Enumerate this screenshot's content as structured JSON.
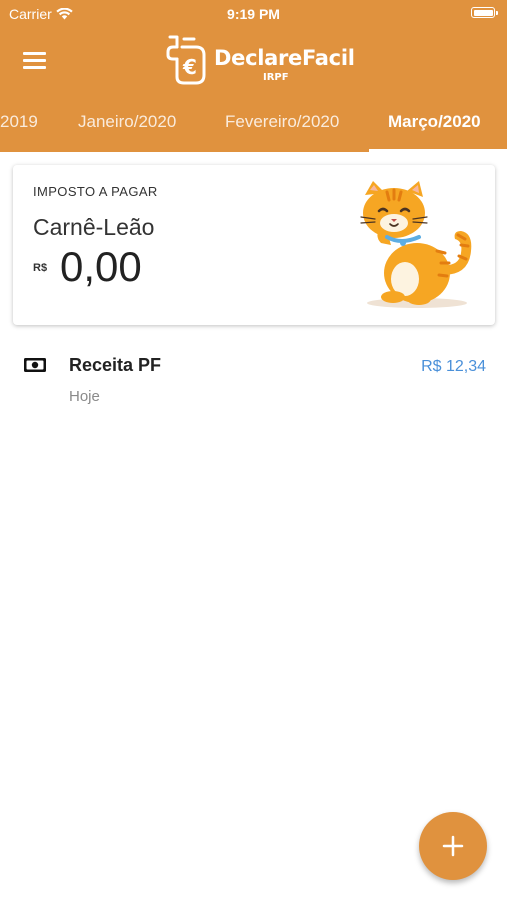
{
  "status_bar": {
    "carrier": "Carrier",
    "time": "9:19 PM"
  },
  "header": {
    "logo_text": "DeclareFacil",
    "logo_subtitle": "IRPF",
    "background_color": "#e0923e",
    "menu_icon": "hamburger-icon"
  },
  "tabs": [
    {
      "label": "2019",
      "active": false
    },
    {
      "label": "Janeiro/2020",
      "active": false
    },
    {
      "label": "Fevereiro/2020",
      "active": false
    },
    {
      "label": "Março/2020",
      "active": true
    }
  ],
  "tax_card": {
    "label": "IMPOSTO A PAGAR",
    "title": "Carnê-Leão",
    "currency": "R$",
    "amount": "0,00",
    "illustration": "orange-cat-mascot"
  },
  "transactions": [
    {
      "icon": "money-icon",
      "title": "Receita PF",
      "date": "Hoje",
      "amount": "R$ 12,34",
      "amount_color": "#4a90d9"
    }
  ],
  "fab": {
    "icon": "plus-icon",
    "color": "#e0923e"
  }
}
